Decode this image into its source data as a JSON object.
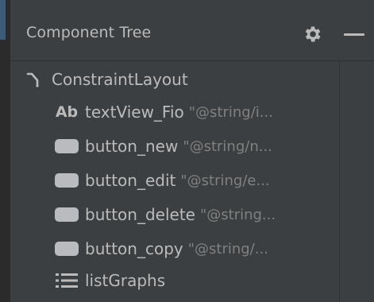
{
  "panel": {
    "title": "Component Tree",
    "settings_icon": "gear-icon",
    "hide_icon": "minus-icon"
  },
  "tree": {
    "root": {
      "label": "ConstraintLayout",
      "icon": "constraint-layout-icon"
    },
    "items": [
      {
        "id": "textView_Fio",
        "attr": "\"@string/i...",
        "icon": "textview-ab-icon",
        "icon_text": "Ab"
      },
      {
        "id": "button_new",
        "attr": "\"@string/n...",
        "icon": "button-icon"
      },
      {
        "id": "button_edit",
        "attr": "\"@string/e...",
        "icon": "button-icon"
      },
      {
        "id": "button_delete",
        "attr": "\"@string...",
        "icon": "button-icon"
      },
      {
        "id": "button_copy",
        "attr": "\"@string/...",
        "icon": "button-icon"
      },
      {
        "id": "listGraphs",
        "attr": "",
        "icon": "list-icon"
      }
    ]
  },
  "colors": {
    "background": "#3c3f41",
    "text": "#bbbbbb",
    "attribute_text": "#808080",
    "accent": "#3b5b76"
  }
}
